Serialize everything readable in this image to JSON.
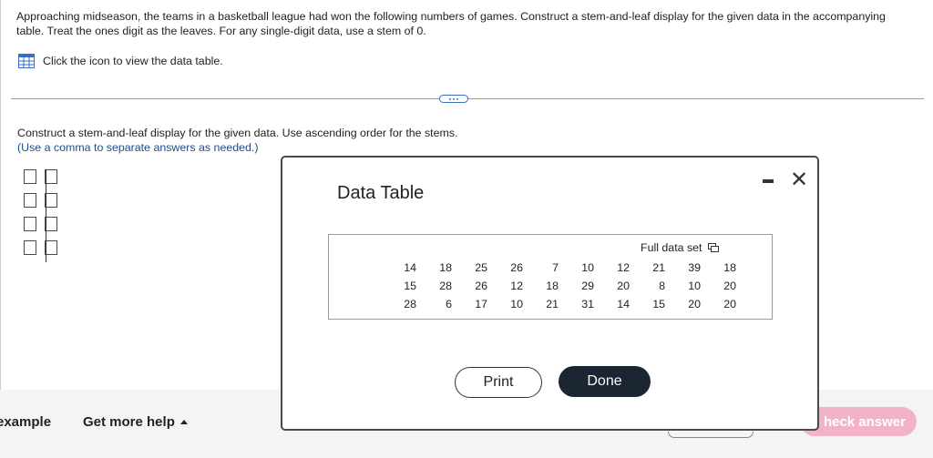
{
  "question": {
    "text": "Approaching midseason, the teams in a basketball league had won the following numbers of games. Construct a stem-and-leaf display for the given data in the accompanying table. Treat the ones digit as the leaves. For any single-digit data, use a stem of 0.",
    "data_link": "Click the icon to view the data table."
  },
  "instructions": {
    "main": "Construct a stem-and-leaf display for the given data. Use ascending order for the stems.",
    "hint": "(Use a comma to separate answers as needed.)"
  },
  "stem_leaf": {
    "rows": 4
  },
  "footer": {
    "example": "example",
    "help": "Get more help",
    "check": "heck answer"
  },
  "modal": {
    "title": "Data Table",
    "full_data_set": "Full data set",
    "rows": [
      [
        "14",
        "18",
        "25",
        "26",
        "7",
        "10",
        "12",
        "21",
        "39",
        "18"
      ],
      [
        "15",
        "28",
        "26",
        "12",
        "18",
        "29",
        "20",
        "8",
        "10",
        "20"
      ],
      [
        "28",
        "6",
        "17",
        "10",
        "21",
        "31",
        "14",
        "15",
        "20",
        "20"
      ]
    ],
    "print": "Print",
    "done": "Done"
  },
  "colors": {
    "accent_blue": "#1d4c8c",
    "done_button": "#1c2532",
    "check_button": "#f2b3c6"
  },
  "icons": [
    "data-table-icon",
    "ellipsis-icon",
    "minimize-icon",
    "close-icon",
    "copy-icon",
    "caret-up-icon"
  ]
}
